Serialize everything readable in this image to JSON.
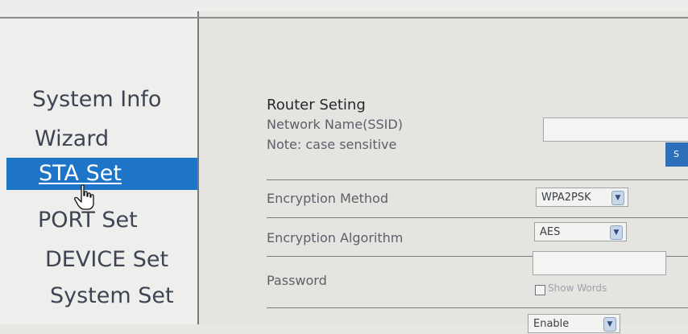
{
  "sidebar": {
    "items": [
      {
        "label": "System Info",
        "active": false
      },
      {
        "label": "Wizard",
        "active": false
      },
      {
        "label": "STA Set",
        "active": true
      },
      {
        "label": "PORT Set",
        "active": false
      },
      {
        "label": "DEVICE Set",
        "active": false
      },
      {
        "label": "System Set",
        "active": false
      }
    ]
  },
  "router": {
    "title": "Router Seting",
    "ssid_label": "Network Name(SSID)",
    "note": "Note: case sensitive",
    "ssid_value": "",
    "save_label": "S"
  },
  "encryption": {
    "method_label": "Encryption Method",
    "method_value": "WPA2PSK",
    "algorithm_label": "Encryption Algorithm",
    "algorithm_value": "AES"
  },
  "password": {
    "label": "Password",
    "value": "",
    "show_words_label": "Show Words"
  },
  "bottom_select": {
    "value": "Enable"
  },
  "colors": {
    "active_nav": "#1e74c6",
    "save_button": "#2d6fb8",
    "background": "#e6e4e1"
  }
}
